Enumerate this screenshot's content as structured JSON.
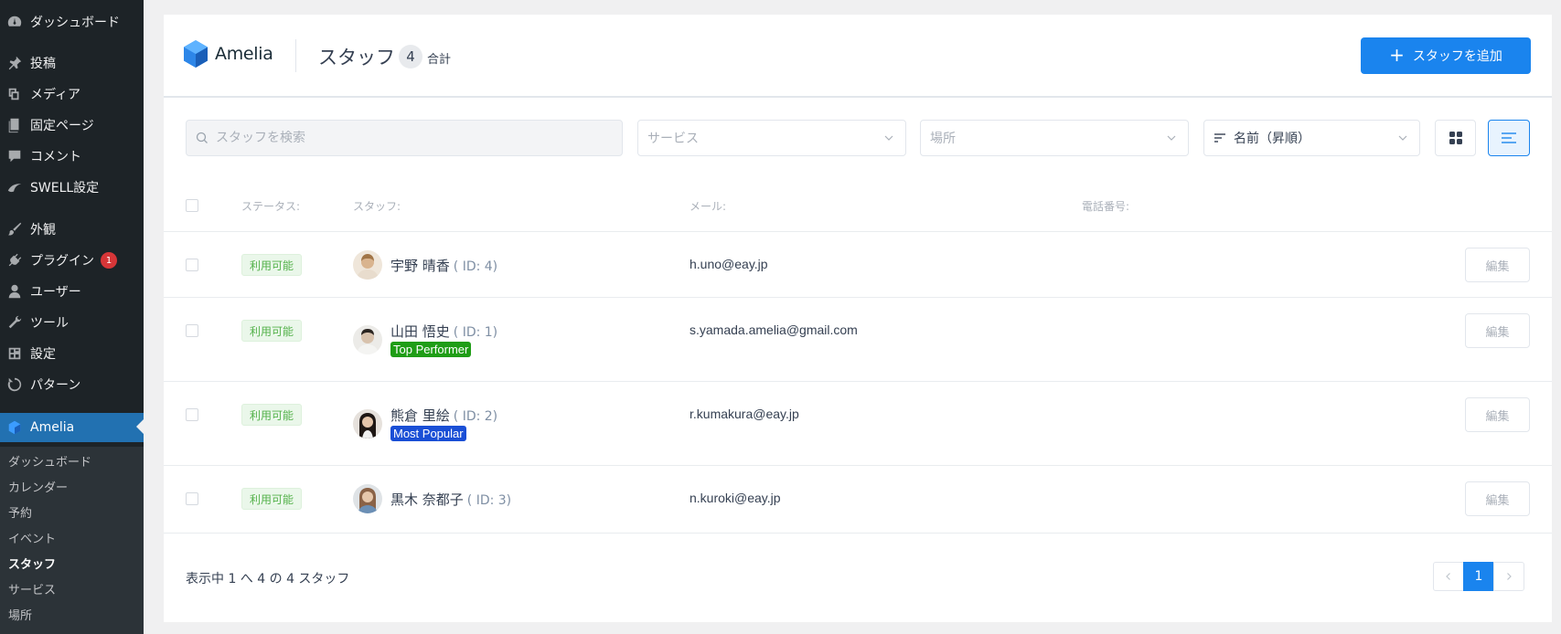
{
  "wp_sidebar": {
    "items": [
      {
        "label": "ダッシュボード",
        "icon": "dashboard-icon"
      },
      {
        "label": "投稿",
        "icon": "pin-icon"
      },
      {
        "label": "メディア",
        "icon": "media-icon"
      },
      {
        "label": "固定ページ",
        "icon": "page-icon"
      },
      {
        "label": "コメント",
        "icon": "comment-icon"
      },
      {
        "label": "SWELL設定",
        "icon": "swell-icon"
      },
      {
        "label": "外観",
        "icon": "brush-icon"
      },
      {
        "label": "プラグイン",
        "icon": "plugin-icon",
        "badge": "1"
      },
      {
        "label": "ユーザー",
        "icon": "user-icon"
      },
      {
        "label": "ツール",
        "icon": "wrench-icon"
      },
      {
        "label": "設定",
        "icon": "settings-icon"
      },
      {
        "label": "パターン",
        "icon": "pattern-icon"
      },
      {
        "label": "Amelia",
        "icon": "amelia-icon"
      }
    ],
    "submenu": [
      "ダッシュボード",
      "カレンダー",
      "予約",
      "イベント",
      "スタッフ",
      "サービス",
      "場所"
    ],
    "current_submenu": "スタッフ"
  },
  "header": {
    "logo_text": "Amelia",
    "title": "スタッフ",
    "count": "4",
    "count_label": "合計",
    "add_button": "スタッフを追加"
  },
  "filters": {
    "search_placeholder": "スタッフを検索",
    "service_placeholder": "サービス",
    "location_placeholder": "場所",
    "sort_value": "名前（昇順）"
  },
  "table": {
    "columns": [
      "ステータス:",
      "スタッフ:",
      "メール:",
      "電話番号:"
    ],
    "edit_label": "編集",
    "rows": [
      {
        "status": "利用可能",
        "name": "宇野 晴香",
        "id": "( ID: 4)",
        "email": "h.uno@eay.jp",
        "tag": null,
        "avatar_color": "#d9b48f"
      },
      {
        "status": "利用可能",
        "name": "山田 悟史",
        "id": "( ID: 1)",
        "email": "s.yamada.amelia@gmail.com",
        "tag": "Top Performer",
        "tag_color": "#1f9d16",
        "avatar_color": "#c9c3bb"
      },
      {
        "status": "利用可能",
        "name": "熊倉 里絵",
        "id": "( ID: 2)",
        "email": "r.kumakura@eay.jp",
        "tag": "Most Popular",
        "tag_color": "#1a4fd6",
        "avatar_color": "#3b2e2a"
      },
      {
        "status": "利用可能",
        "name": "黒木 奈都子",
        "id": "( ID: 3)",
        "email": "n.kuroki@eay.jp",
        "tag": null,
        "avatar_color": "#a88363"
      }
    ]
  },
  "footer": {
    "summary": "表示中 1 へ 4 の 4 スタッフ",
    "current_page": "1"
  },
  "colors": {
    "accent": "#1a84ee",
    "wp_sidebar_bg": "#1d2327",
    "wp_active": "#2271b1",
    "status_green": "#54b24b"
  }
}
